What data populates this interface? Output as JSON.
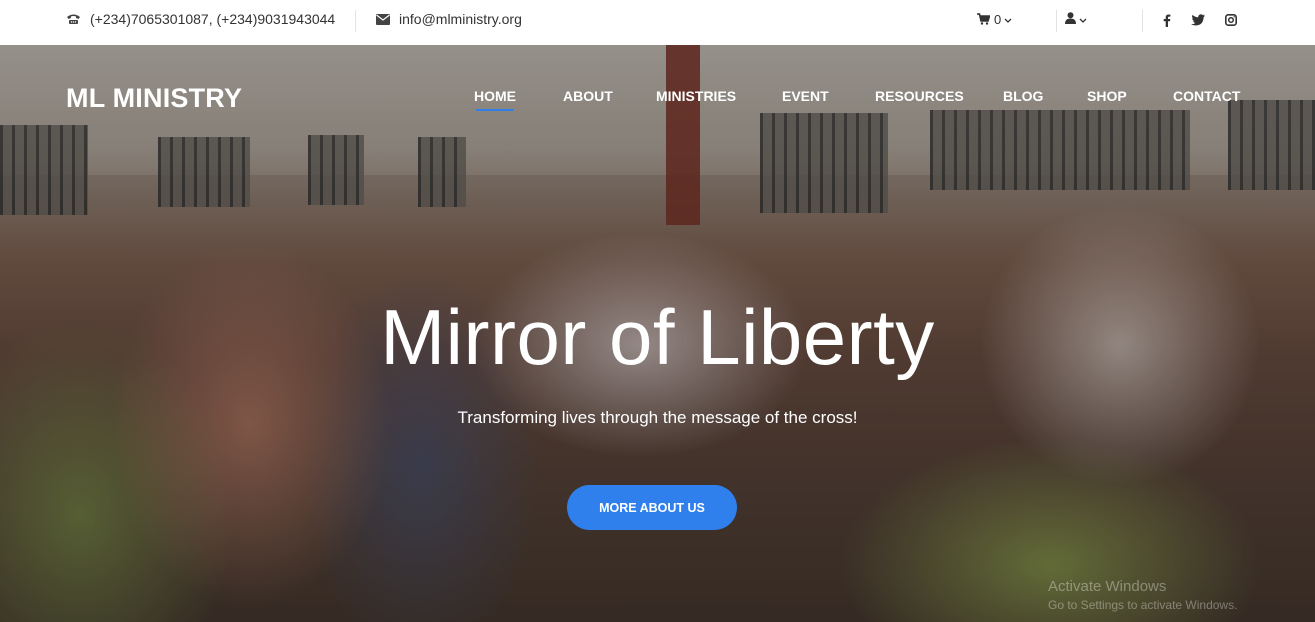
{
  "topbar": {
    "phone_icon": "phone-icon",
    "phone": "(+234)7065301087, (+234)9031943044",
    "email_icon": "envelope-icon",
    "email": "info@mlministry.org",
    "cart_icon": "cart-icon",
    "cart_count": "0",
    "user_icon": "user-icon",
    "social": [
      "facebook-icon",
      "twitter-icon",
      "instagram-icon"
    ]
  },
  "header": {
    "brand": "ML MINISTRY",
    "nav": [
      {
        "label": "HOME",
        "active": true
      },
      {
        "label": "ABOUT"
      },
      {
        "label": "MINISTRIES"
      },
      {
        "label": "EVENT"
      },
      {
        "label": "RESOURCES"
      },
      {
        "label": "BLOG"
      },
      {
        "label": "SHOP"
      },
      {
        "label": "CONTACT"
      }
    ],
    "accent": "#2f80ed"
  },
  "hero": {
    "title": "Mirror of Liberty",
    "subtitle": "Transforming lives through the message of the cross!",
    "cta": "MORE ABOUT US"
  },
  "overlay_text": {
    "line1": "Activate Windows",
    "line2": "Go to Settings to activate Windows."
  }
}
